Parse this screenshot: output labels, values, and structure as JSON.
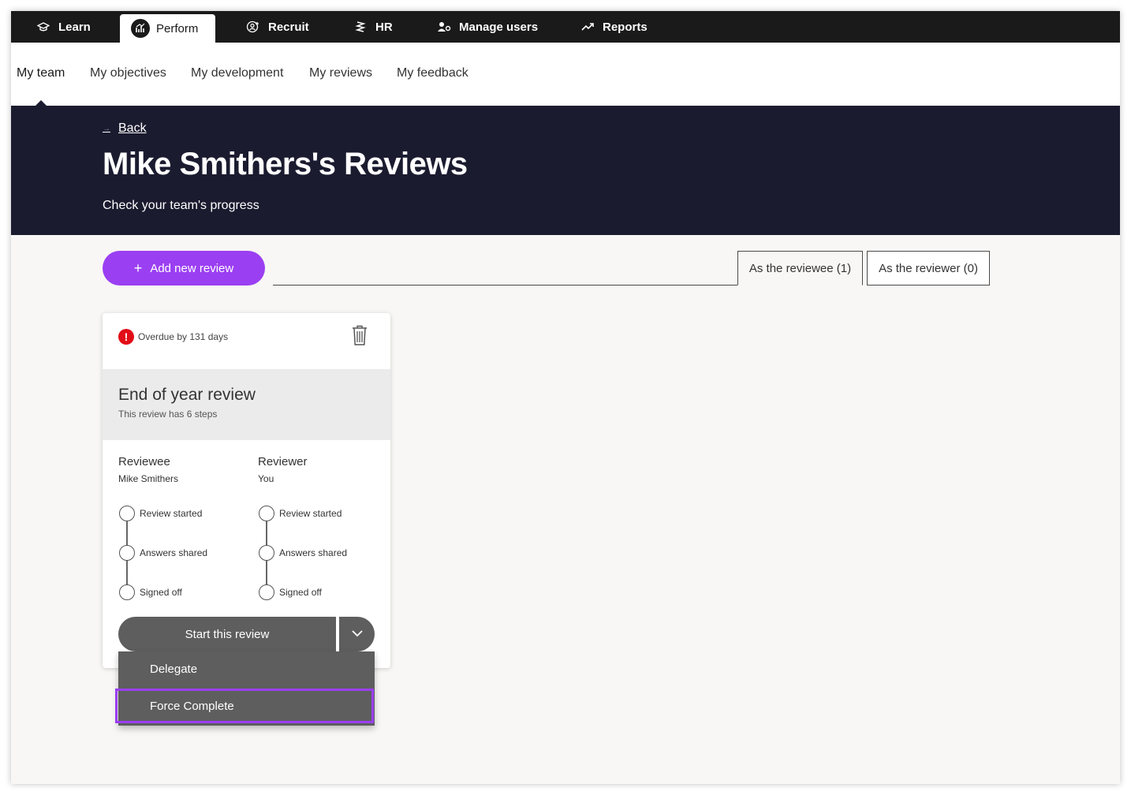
{
  "top_nav": {
    "items": [
      {
        "label": "Learn",
        "icon": "graduation-cap-icon"
      },
      {
        "label": "Perform",
        "icon": "chart-icon",
        "active": true
      },
      {
        "label": "Recruit",
        "icon": "recruit-icon"
      },
      {
        "label": "HR",
        "icon": "hr-icon"
      },
      {
        "label": "Manage users",
        "icon": "users-gear-icon"
      },
      {
        "label": "Reports",
        "icon": "trend-icon"
      }
    ]
  },
  "sub_nav": {
    "items": [
      {
        "label": "My team",
        "active": true
      },
      {
        "label": "My objectives"
      },
      {
        "label": "My development"
      },
      {
        "label": "My reviews"
      },
      {
        "label": "My feedback"
      }
    ]
  },
  "banner": {
    "back_label": "Back",
    "title": "Mike Smithers's Reviews",
    "subtitle": "Check your team's progress"
  },
  "actions": {
    "add_review_label": "Add new review",
    "tabs": [
      {
        "label": "As the reviewee (1)",
        "active": true
      },
      {
        "label": "As the reviewer (0)"
      }
    ]
  },
  "review_card": {
    "status": "Overdue by 131 days",
    "title": "End of year review",
    "steps_text": "This review has 6 steps",
    "reviewee": {
      "heading": "Reviewee",
      "name": "Mike Smithers",
      "steps": [
        "Review started",
        "Answers shared",
        "Signed off"
      ]
    },
    "reviewer": {
      "heading": "Reviewer",
      "name": "You",
      "steps": [
        "Review started",
        "Answers shared",
        "Signed off"
      ]
    },
    "start_label": "Start this review",
    "menu": [
      "Delegate",
      "Force Complete"
    ]
  },
  "colors": {
    "accent": "#9b3ff2",
    "banner": "#1b1b30",
    "nav": "#1a1a1a",
    "overdue": "#e10d17",
    "button": "#5e5e5e"
  }
}
